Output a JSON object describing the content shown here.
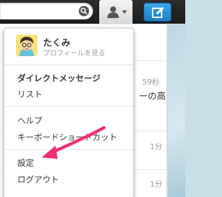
{
  "topbar": {
    "search_placeholder": "",
    "icons": [
      "search-icon",
      "person-icon",
      "chevron-down-icon",
      "compose-icon"
    ]
  },
  "dropdown": {
    "profile": {
      "name": "たくみ",
      "subtitle": "プロフィールを見る"
    },
    "items": [
      {
        "label": "ダイレクトメッセージ",
        "bold": true
      },
      {
        "label": "リスト"
      },
      {
        "label": "ヘルプ"
      },
      {
        "label": "キーボードショートカット"
      },
      {
        "label": "設定"
      },
      {
        "label": "ログアウト"
      }
    ]
  },
  "timeline": {
    "rows": [
      {
        "time": "59秒",
        "text": "ーの高"
      },
      {
        "time": "1分"
      },
      {
        "time": "1分"
      }
    ]
  },
  "colors": {
    "topbar": "#222222",
    "compose_button": "#2a93d9",
    "arrow": "#ee2f6e",
    "background": "#c9dfe8"
  }
}
